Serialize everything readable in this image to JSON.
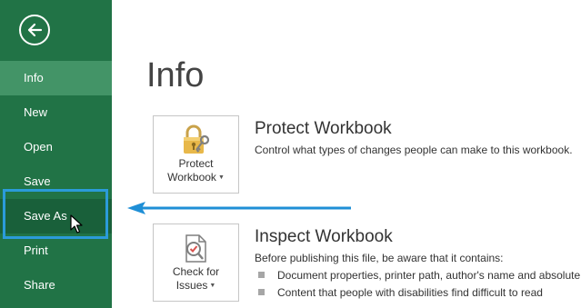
{
  "sidebar": {
    "back_icon": "back-arrow-icon",
    "items": [
      {
        "label": "Info"
      },
      {
        "label": "New"
      },
      {
        "label": "Open"
      },
      {
        "label": "Save"
      },
      {
        "label": "Save As"
      },
      {
        "label": "Print"
      },
      {
        "label": "Share"
      }
    ],
    "colors": {
      "background": "#217346",
      "active": "#439467",
      "highlight": "#2b9bd9"
    }
  },
  "main": {
    "title": "Info",
    "protect": {
      "button_line1": "Protect",
      "button_line2": "Workbook",
      "icon": "lock-key-icon",
      "heading": "Protect Workbook",
      "description": "Control what types of changes people can make to this workbook."
    },
    "inspect": {
      "button_line1": "Check for",
      "button_line2": "Issues",
      "icon": "inspect-document-icon",
      "heading": "Inspect Workbook",
      "description": "Before publishing this file, be aware that it contains:",
      "bullets": [
        "Document properties, printer path, author's name and absolute",
        "Content that people with disabilities find difficult to read"
      ]
    }
  },
  "annotation": {
    "arrow_color": "#1f8fd6"
  }
}
